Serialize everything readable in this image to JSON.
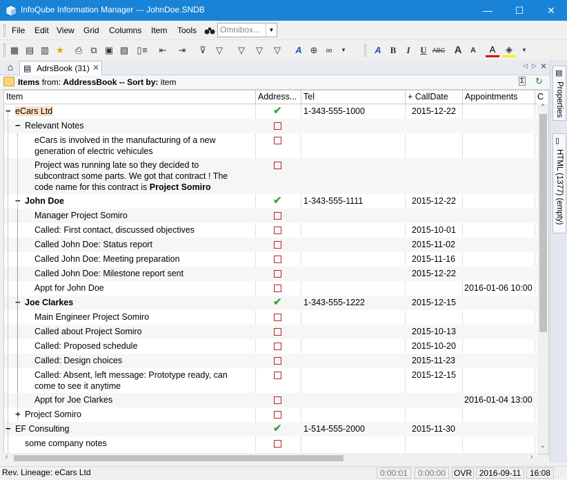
{
  "window": {
    "title": "InfoQube Information Manager  ---  JohnDoe.SNDB",
    "minimize_glyph": "—",
    "maximize_glyph": "☐",
    "close_glyph": "✕"
  },
  "menu": {
    "items": [
      "File",
      "Edit",
      "View",
      "Grid",
      "Columns",
      "Item",
      "Tools"
    ],
    "omnibox_placeholder": "Omnibox..."
  },
  "toolbar": {
    "icons": [
      "grid-view-icon",
      "document-view-icon",
      "calendar-view-icon",
      "favorite-icon",
      "print-preview-icon",
      "export-icon",
      "image-icon",
      "import-icon",
      "page-icon",
      "indent-icon",
      "outdent-icon",
      "move-icon",
      "filter-icon",
      "column-filter-icon",
      "clear-filter-icon",
      "clear-filter-2-icon",
      "highlight-icon",
      "zoom-icon",
      "link-icon",
      "style-icon",
      "bold-icon",
      "italic-icon",
      "underline-icon",
      "strikethrough-icon",
      "grow-font-icon",
      "shrink-font-icon",
      "font-color-icon",
      "fill-color-icon"
    ]
  },
  "tabs": {
    "active_label": "AdrsBook (31)"
  },
  "infobar": {
    "items_label": "Items",
    "from_label": "from:",
    "source": "AddressBook",
    "sort_label": "-- Sort by:",
    "sort_field": "item"
  },
  "columns": {
    "item": "Item",
    "address": "Address...",
    "tel": "Tel",
    "calldate": "CallDate",
    "appointments": "Appointments",
    "extra": "C"
  },
  "rows": [
    {
      "text": "eCars Ltd",
      "level": 0,
      "expander": "−",
      "bold": false,
      "check": "tick",
      "tel": "1-343-555-1000",
      "calldate": "2015-12-22",
      "appt": ""
    },
    {
      "text": "Relevant Notes",
      "level": 1,
      "expander": "−",
      "bold": false,
      "check": "box",
      "tel": "",
      "calldate": "",
      "appt": ""
    },
    {
      "text": "eCars is involved in the manufacturing of a new",
      "text2": "generation of electric vehicules",
      "level": 2,
      "expander": "",
      "bold": false,
      "check": "box",
      "tel": "",
      "calldate": "",
      "appt": ""
    },
    {
      "text": "Project was running late so they decided to",
      "text2": "subcontract some parts. We got that contract ! The",
      "text3": "code name for this contract is ",
      "text3b": "Project Somiro",
      "level": 2,
      "expander": "",
      "bold": false,
      "check": "box",
      "tel": "",
      "calldate": "",
      "appt": ""
    },
    {
      "text": "John Doe",
      "level": 1,
      "expander": "−",
      "bold": true,
      "check": "tick",
      "tel": "1-343-555-1111",
      "calldate": "2015-12-22",
      "appt": ""
    },
    {
      "text": "Manager Project Somiro",
      "level": 2,
      "expander": "",
      "bold": false,
      "check": "box",
      "tel": "",
      "calldate": "",
      "appt": ""
    },
    {
      "text": "Called: First contact, discussed objectives",
      "level": 2,
      "expander": "",
      "bold": false,
      "check": "box",
      "tel": "",
      "calldate": "2015-10-01",
      "appt": ""
    },
    {
      "text": "Called John Doe: Status report",
      "level": 2,
      "expander": "",
      "bold": false,
      "check": "box",
      "tel": "",
      "calldate": "2015-11-02",
      "appt": ""
    },
    {
      "text": "Called John Doe: Meeting preparation",
      "level": 2,
      "expander": "",
      "bold": false,
      "check": "box",
      "tel": "",
      "calldate": "2015-11-16",
      "appt": ""
    },
    {
      "text": "Called John Doe: Milestone report sent",
      "level": 2,
      "expander": "",
      "bold": false,
      "check": "box",
      "tel": "",
      "calldate": "2015-12-22",
      "appt": ""
    },
    {
      "text": "Appt for John Doe",
      "level": 2,
      "expander": "",
      "bold": false,
      "check": "box",
      "tel": "",
      "calldate": "",
      "appt": "2016-01-06 10:00"
    },
    {
      "text": "Joe Clarkes",
      "level": 1,
      "expander": "−",
      "bold": true,
      "check": "tick",
      "tel": "1-343-555-1222",
      "calldate": "2015-12-15",
      "appt": ""
    },
    {
      "text": "Main Engineer Project Somiro",
      "level": 2,
      "expander": "",
      "bold": false,
      "check": "box",
      "tel": "",
      "calldate": "",
      "appt": ""
    },
    {
      "text": "Called about Project Somiro",
      "level": 2,
      "expander": "",
      "bold": false,
      "check": "box",
      "tel": "",
      "calldate": "2015-10-13",
      "appt": ""
    },
    {
      "text": "Called: Proposed schedule",
      "level": 2,
      "expander": "",
      "bold": false,
      "check": "box",
      "tel": "",
      "calldate": "2015-10-20",
      "appt": ""
    },
    {
      "text": "Called: Design choices",
      "level": 2,
      "expander": "",
      "bold": false,
      "check": "box",
      "tel": "",
      "calldate": "2015-11-23",
      "appt": ""
    },
    {
      "text": "Called: Absent, left message: Prototype ready, can",
      "text2": "come to see it anytime",
      "level": 2,
      "expander": "",
      "bold": false,
      "check": "box",
      "tel": "",
      "calldate": "2015-12-15",
      "appt": ""
    },
    {
      "text": "Appt for Joe Clarkes",
      "level": 2,
      "expander": "",
      "bold": false,
      "check": "box",
      "tel": "",
      "calldate": "",
      "appt": "2016-01-04 13:00"
    },
    {
      "text": "Project Somiro",
      "level": 1,
      "expander": "+",
      "bold": false,
      "check": "box",
      "tel": "",
      "calldate": "",
      "appt": ""
    },
    {
      "text": "EF Consulting",
      "level": 0,
      "expander": "−",
      "bold": false,
      "check": "tick",
      "tel": "1-514-555-2000",
      "calldate": "2015-11-30",
      "appt": ""
    },
    {
      "text": "some company notes",
      "level": 1,
      "expander": "",
      "bold": false,
      "check": "box",
      "tel": "",
      "calldate": "",
      "appt": ""
    }
  ],
  "right_panel": {
    "properties_tab": "Properties",
    "html_tab": "HTML (1377) (empty)"
  },
  "status": {
    "lineage": "Rev. Lineage: eCars Ltd",
    "timer1": "0:00:01",
    "timer2": "0:00:00",
    "mode": "OVR",
    "date": "2016-09-11",
    "time": "16:08"
  },
  "colors": {
    "titlebar": "#1883d7",
    "selected_row": "#fddfc3",
    "checkbox_border": "#b22222",
    "tick": "#3ba53b"
  }
}
